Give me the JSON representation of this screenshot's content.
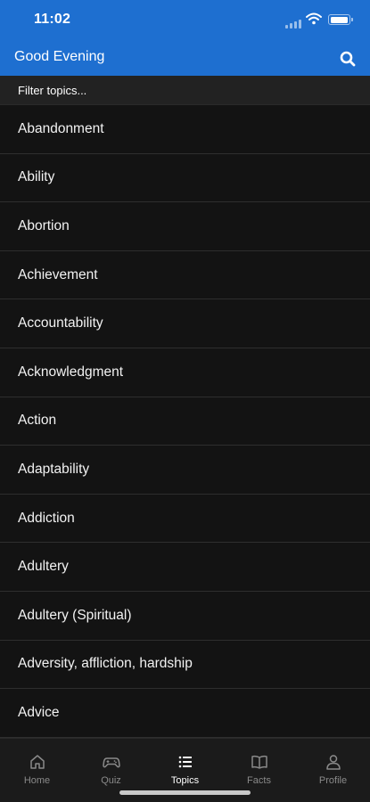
{
  "status_bar": {
    "time": "11:02"
  },
  "header": {
    "greeting": "Good Evening",
    "search_icon": "search-icon"
  },
  "filter": {
    "placeholder": "Filter topics..."
  },
  "topics": [
    "Abandonment",
    "Ability",
    "Abortion",
    "Achievement",
    "Accountability",
    "Acknowledgment",
    "Action",
    "Adaptability",
    "Addiction",
    "Adultery",
    "Adultery (Spiritual)",
    "Adversity, affliction, hardship",
    "Advice"
  ],
  "tabs": [
    {
      "label": "Home",
      "icon": "home-icon",
      "active": false
    },
    {
      "label": "Quiz",
      "icon": "gamepad-icon",
      "active": false
    },
    {
      "label": "Topics",
      "icon": "list-icon",
      "active": true
    },
    {
      "label": "Facts",
      "icon": "book-icon",
      "active": false
    },
    {
      "label": "Profile",
      "icon": "person-icon",
      "active": false
    }
  ],
  "colors": {
    "header_blue": "#1e6fd0",
    "background": "#111111",
    "tab_bar": "#1b1b1b"
  }
}
